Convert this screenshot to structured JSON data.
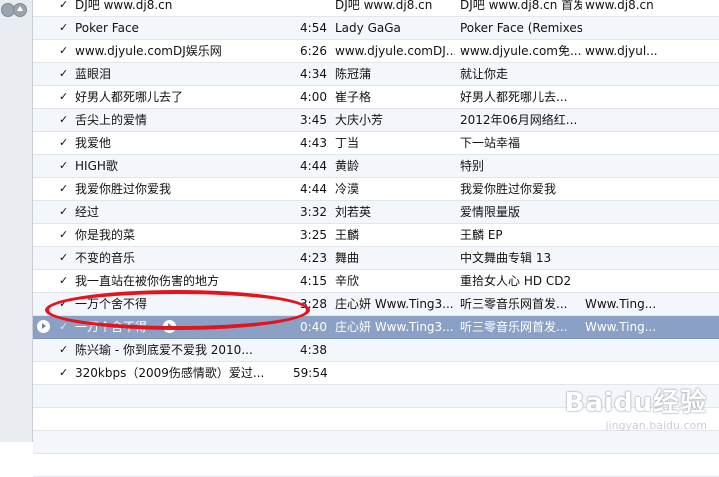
{
  "songs": [
    {
      "name": "DJ吧 www.dj8.cn",
      "time": "",
      "artist": "DJ吧 www.dj8.cn",
      "album": "DJ吧 www.dj8.cn 首发",
      "extra": "www.dj8.cn"
    },
    {
      "name": "Poker Face",
      "time": "4:54",
      "artist": "Lady GaGa",
      "album": "Poker Face (Remixes)",
      "extra": ""
    },
    {
      "name": "www.djyule.comDJ娱乐网",
      "time": "6:26",
      "artist": "www.djyule.comDJ...",
      "album": "www.djyule.com免...",
      "extra": "www.djyul..."
    },
    {
      "name": "蓝眼泪",
      "time": "4:34",
      "artist": "陈冠蒲",
      "album": "就让你走",
      "extra": ""
    },
    {
      "name": "好男人都死哪儿去了",
      "time": "4:00",
      "artist": "崔子格",
      "album": "好男人都死哪儿去...",
      "extra": ""
    },
    {
      "name": "舌尖上的爱情",
      "time": "3:45",
      "artist": "大庆小芳",
      "album": "2012年06月网络红...",
      "extra": ""
    },
    {
      "name": "我爱他",
      "time": "4:43",
      "artist": "丁当",
      "album": "下一站幸福",
      "extra": ""
    },
    {
      "name": "HIGH歌",
      "time": "4:44",
      "artist": "黄龄",
      "album": "特别",
      "extra": ""
    },
    {
      "name": "我爱你胜过你爱我",
      "time": "4:44",
      "artist": "冷漠",
      "album": "我爱你胜过你爱我",
      "extra": ""
    },
    {
      "name": "经过",
      "time": "3:32",
      "artist": "刘若英",
      "album": "爱情限量版",
      "extra": ""
    },
    {
      "name": "你是我的菜",
      "time": "3:25",
      "artist": "王麟",
      "album": "王麟 EP",
      "extra": ""
    },
    {
      "name": "不变的音乐",
      "time": "4:23",
      "artist": "舞曲",
      "album": "中文舞曲专辑 13",
      "extra": ""
    },
    {
      "name": "我一直站在被你伤害的地方",
      "time": "4:15",
      "artist": "辛欣",
      "album": "重拾女人心 HD CD2",
      "extra": ""
    },
    {
      "name": "一万个舍不得",
      "time": "3:28",
      "artist": "庄心妍 Www.Ting3...",
      "album": "听三零音乐网首发...",
      "extra": "Www.Ting..."
    },
    {
      "name": "一万个舍不得",
      "time": "0:40",
      "artist": "庄心妍 Www.Ting3...",
      "album": "听三零音乐网首发...",
      "extra": "Www.Ting..."
    },
    {
      "name": "陈兴瑜 - 你到底爱不爱我 2010...",
      "time": "4:38",
      "artist": "",
      "album": "",
      "extra": ""
    },
    {
      "name": "320kbps（2009伤感情歌）爱过...",
      "time": "59:54",
      "artist": "",
      "album": "",
      "extra": ""
    },
    {
      "name": "",
      "time": "",
      "artist": "",
      "album": "",
      "extra": ""
    },
    {
      "name": "",
      "time": "",
      "artist": "",
      "album": "",
      "extra": ""
    },
    {
      "name": "",
      "time": "",
      "artist": "",
      "album": "",
      "extra": ""
    },
    {
      "name": "",
      "time": "",
      "artist": "",
      "album": "",
      "extra": ""
    }
  ],
  "checkmark": "✓",
  "watermark": {
    "main": "Baidu经验",
    "sub": "jingyan.baidu.com"
  },
  "colors": {
    "selected_row": "#8aa0c4",
    "highlight_ellipse": "#e4141c"
  }
}
